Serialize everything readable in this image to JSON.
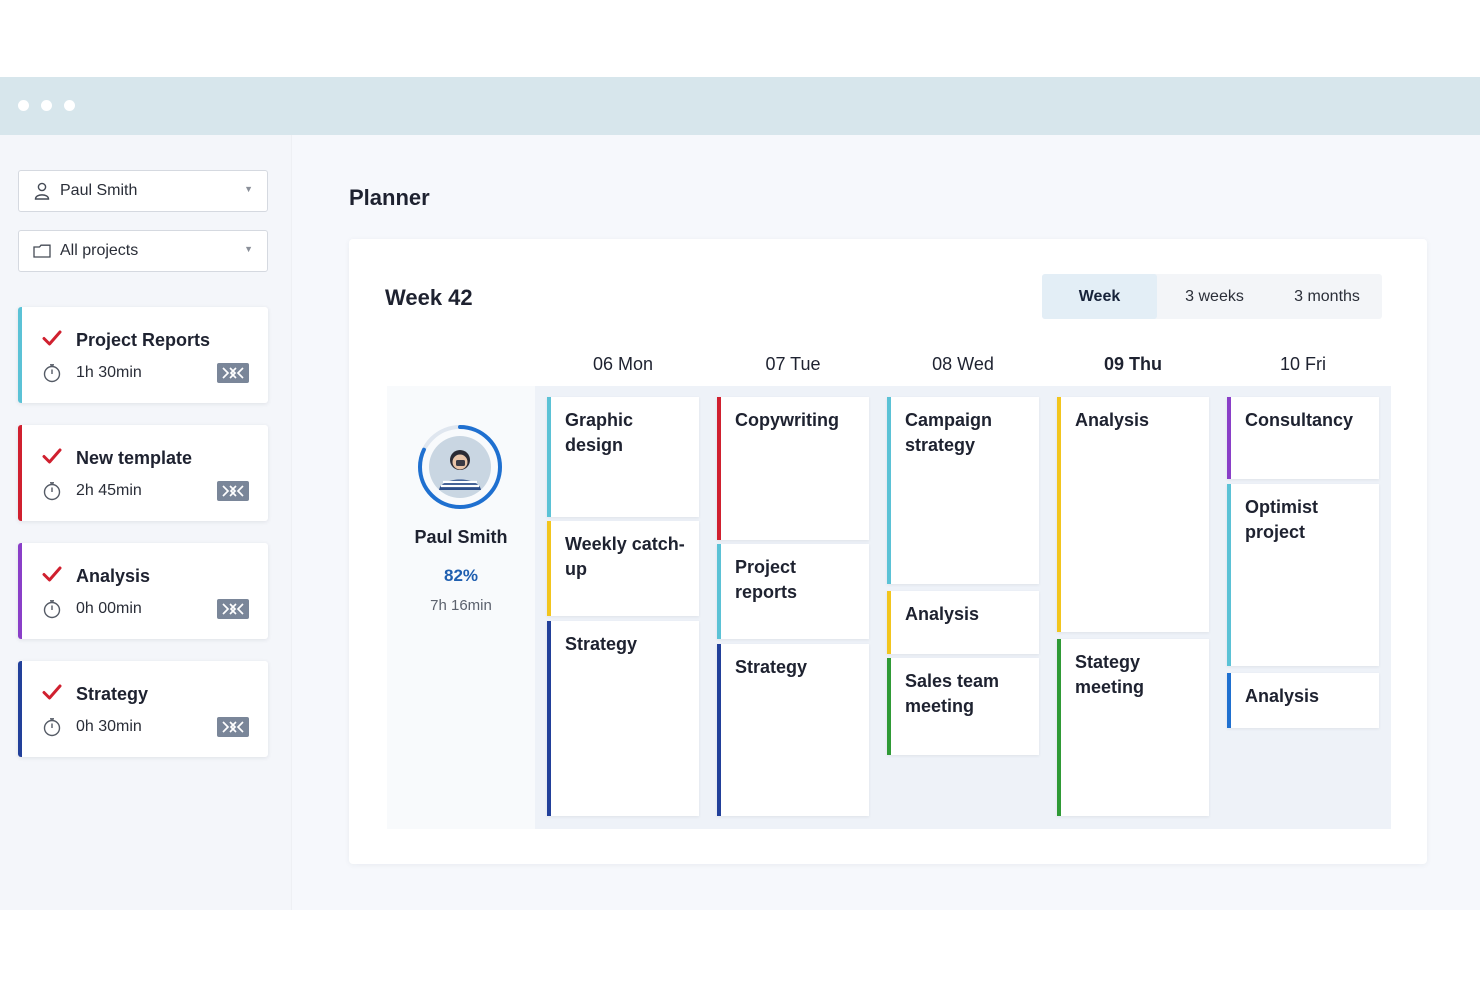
{
  "app": {
    "colors": {
      "titlebar": "#d7e6ec",
      "cyan": "#5bc2d6",
      "red": "#d0202f",
      "purple": "#8a3fc8",
      "navy": "#22409a",
      "yellow": "#f2c51e",
      "green": "#2f9a36",
      "blue": "#1f70d0",
      "accent": "#1f5fb0"
    }
  },
  "sidebar": {
    "user_select": {
      "value": "Paul Smith",
      "icon": "user-icon"
    },
    "project_select": {
      "value": "All projects",
      "icon": "folder-icon"
    },
    "tasks": [
      {
        "name": "Project Reports",
        "time": "1h 30min",
        "color": "#5bc2d6"
      },
      {
        "name": "New template",
        "time": "2h 45min",
        "color": "#d0202f"
      },
      {
        "name": "Analysis",
        "time": "0h 00min",
        "color": "#8a3fc8"
      },
      {
        "name": "Strategy",
        "time": "0h 30min",
        "color": "#22409a"
      }
    ]
  },
  "main": {
    "title": "Planner",
    "week_label": "Week 42",
    "view_options": [
      "Week",
      "3 weeks",
      "3 months"
    ],
    "active_view": "Week",
    "days": [
      {
        "label": "06 Mon",
        "today": false
      },
      {
        "label": "07 Tue",
        "today": false
      },
      {
        "label": "08 Wed",
        "today": false
      },
      {
        "label": "09 Thu",
        "today": true
      },
      {
        "label": "10 Fri",
        "today": false
      }
    ],
    "person": {
      "name": "Paul Smith",
      "utilization": "82%",
      "hours": "7h 16min"
    },
    "events": [
      [
        {
          "title": "Graphic design",
          "color": "#5bc2d6"
        },
        {
          "title": "Weekly catch-up",
          "color": "#f2c51e"
        },
        {
          "title": "Strategy",
          "color": "#22409a"
        }
      ],
      [
        {
          "title": "Copywriting",
          "color": "#d0202f"
        },
        {
          "title": "Project reports",
          "color": "#5bc2d6"
        },
        {
          "title": "Strategy",
          "color": "#22409a"
        }
      ],
      [
        {
          "title": "Campaign strategy",
          "color": "#5bc2d6"
        },
        {
          "title": "Analysis",
          "color": "#f2c51e"
        },
        {
          "title": "Sales team meeting",
          "color": "#2f9a36"
        }
      ],
      [
        {
          "title": "Analysis",
          "color": "#f2c51e"
        },
        {
          "title": "Stategy meeting",
          "color": "#2f9a36"
        }
      ],
      [
        {
          "title": "Consultancy",
          "color": "#8a3fc8"
        },
        {
          "title": "Optimist project",
          "color": "#5bc2d6"
        },
        {
          "title": "Analysis",
          "color": "#1f70d0"
        }
      ]
    ]
  }
}
